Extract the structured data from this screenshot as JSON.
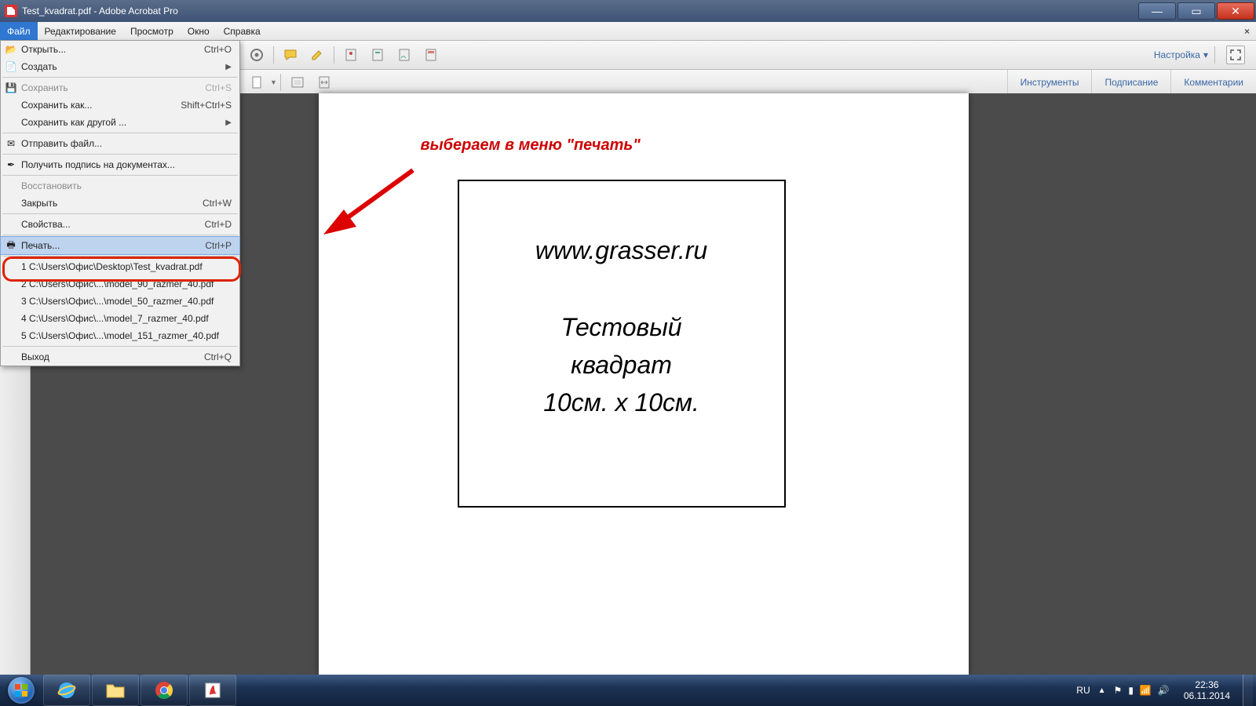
{
  "window": {
    "title": "Test_kvadrat.pdf - Adobe Acrobat Pro"
  },
  "menubar": {
    "items": [
      "Файл",
      "Редактирование",
      "Просмотр",
      "Окно",
      "Справка"
    ]
  },
  "toolbar": {
    "settings_label": "Настройка"
  },
  "panes": {
    "tools": "Инструменты",
    "sign": "Подписание",
    "comments": "Комментарии"
  },
  "file_menu": {
    "open": {
      "label": "Открыть...",
      "shortcut": "Ctrl+O"
    },
    "create": {
      "label": "Создать"
    },
    "save": {
      "label": "Сохранить",
      "shortcut": "Ctrl+S"
    },
    "save_as": {
      "label": "Сохранить как...",
      "shortcut": "Shift+Ctrl+S"
    },
    "save_other": {
      "label": "Сохранить как другой ..."
    },
    "send": {
      "label": "Отправить файл..."
    },
    "get_sign": {
      "label": "Получить подпись на документах..."
    },
    "revert": {
      "label": "Восстановить"
    },
    "close": {
      "label": "Закрыть",
      "shortcut": "Ctrl+W"
    },
    "props": {
      "label": "Свойства...",
      "shortcut": "Ctrl+D"
    },
    "print": {
      "label": "Печать...",
      "shortcut": "Ctrl+P"
    },
    "recent": [
      "1 C:\\Users\\Офис\\Desktop\\Test_kvadrat.pdf",
      "2 C:\\Users\\Офис\\...\\model_90_razmer_40.pdf",
      "3 C:\\Users\\Офис\\...\\model_50_razmer_40.pdf",
      "4 C:\\Users\\Офис\\...\\model_7_razmer_40.pdf",
      "5 C:\\Users\\Офис\\...\\model_151_razmer_40.pdf"
    ],
    "exit": {
      "label": "Выход",
      "shortcut": "Ctrl+Q"
    }
  },
  "annotation": {
    "text": "выбераем в меню \"печать\""
  },
  "document": {
    "url": "www.grasser.ru",
    "line1": "Тестовый",
    "line2": "квадрат",
    "line3": "10см. х 10см."
  },
  "taskbar": {
    "lang": "RU",
    "time": "22:36",
    "date": "06.11.2014"
  }
}
